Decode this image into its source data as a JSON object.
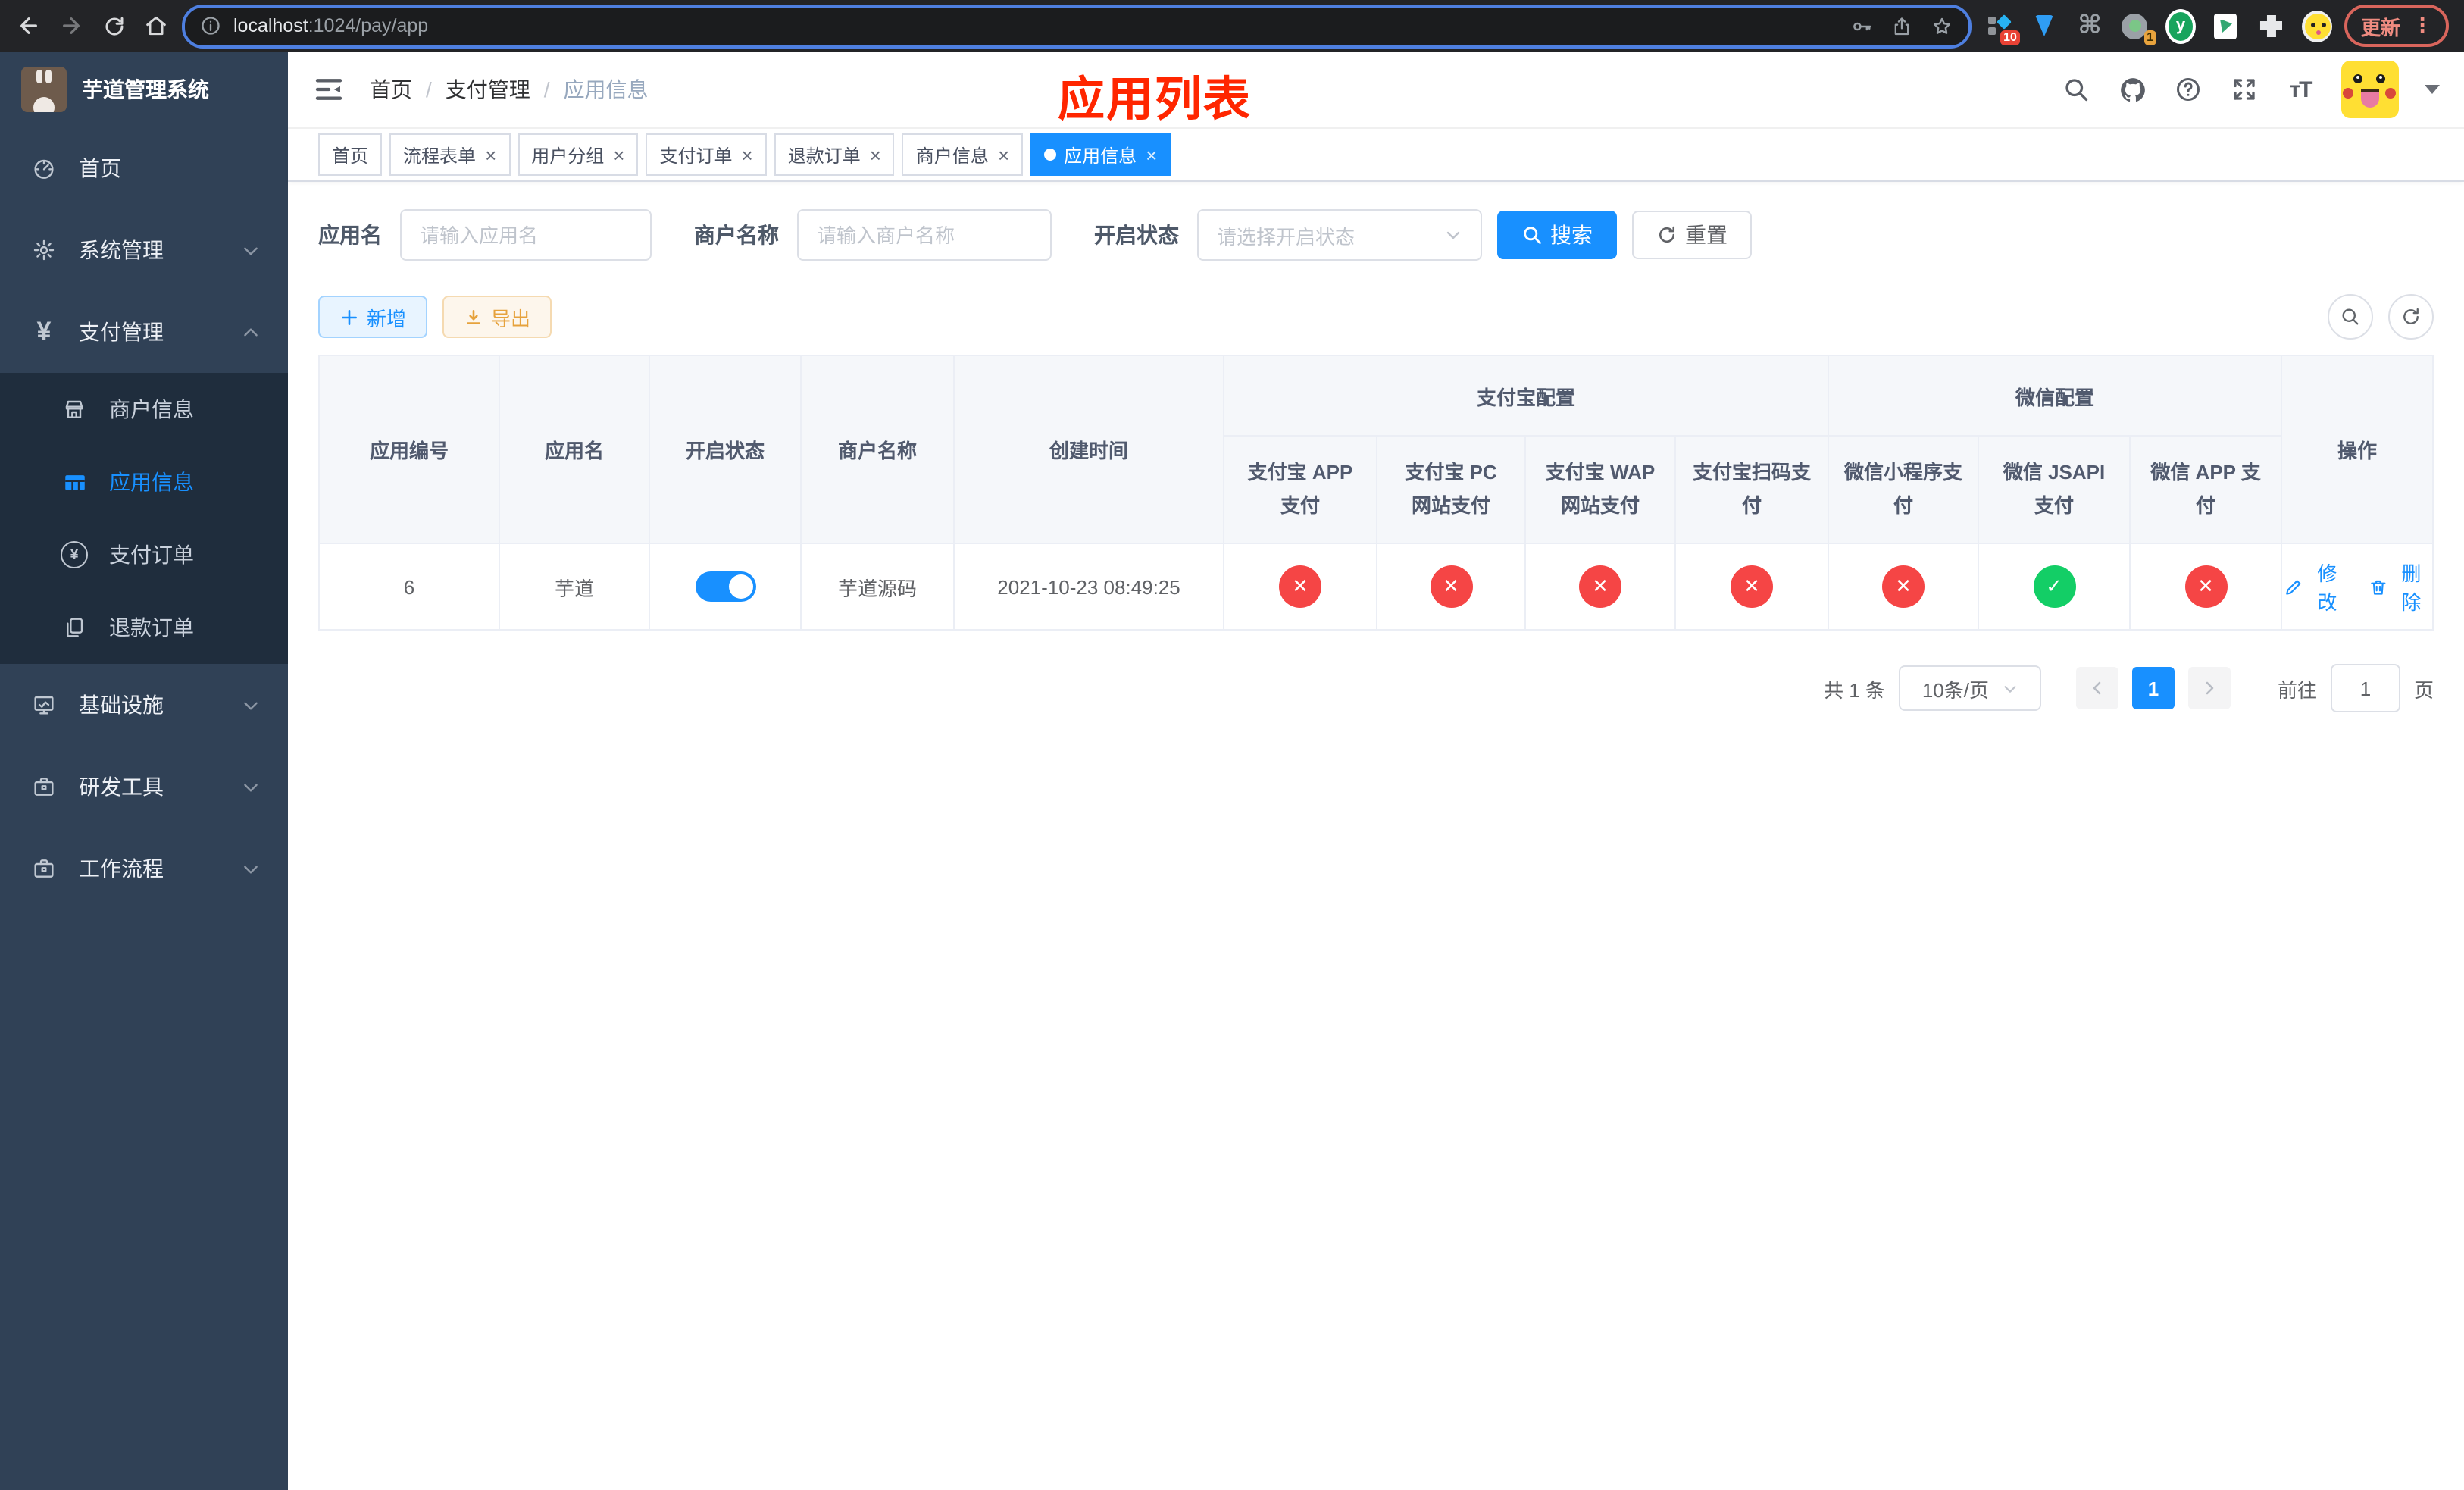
{
  "colors": {
    "primary": "#1890ff",
    "danger": "#f54545",
    "success": "#13ce66",
    "warning": "#e6a23c",
    "annotation": "#ff2600",
    "sidebar_bg": "#304156",
    "submenu_bg": "#1f2d3d"
  },
  "browser": {
    "url_host": "localhost",
    "url_rest": ":1024/pay/app",
    "update_label": "更新",
    "ext_badge_10": "10",
    "ext_badge_1": "1",
    "y_ext_label": "y"
  },
  "sidebar": {
    "title": "芋道管理系统",
    "items": [
      {
        "key": "home",
        "label": "首页",
        "icon": "dashboard-icon"
      },
      {
        "key": "system",
        "label": "系统管理",
        "icon": "gear-icon",
        "chevron": "down"
      },
      {
        "key": "payment",
        "label": "支付管理",
        "icon": "yen-icon",
        "chevron": "up",
        "children": [
          {
            "key": "merchant-info",
            "label": "商户信息",
            "icon": "shop-icon"
          },
          {
            "key": "app-info",
            "label": "应用信息",
            "icon": "grid-icon",
            "active": true
          },
          {
            "key": "pay-order",
            "label": "支付订单",
            "icon": "yen-circle-icon"
          },
          {
            "key": "refund-order",
            "label": "退款订单",
            "icon": "document-icon"
          }
        ]
      },
      {
        "key": "infrastructure",
        "label": "基础设施",
        "icon": "monitor-icon",
        "chevron": "down"
      },
      {
        "key": "dev-tools",
        "label": "研发工具",
        "icon": "toolbox-icon",
        "chevron": "down"
      },
      {
        "key": "workflow",
        "label": "工作流程",
        "icon": "toolbox-icon",
        "chevron": "down"
      }
    ]
  },
  "app_header": {
    "breadcrumb": [
      "首页",
      "支付管理",
      "应用信息"
    ],
    "separator": "/",
    "annotation": "应用列表"
  },
  "tabs": [
    {
      "label": "首页",
      "closable": false,
      "active": false
    },
    {
      "label": "流程表单",
      "closable": true,
      "active": false
    },
    {
      "label": "用户分组",
      "closable": true,
      "active": false
    },
    {
      "label": "支付订单",
      "closable": true,
      "active": false
    },
    {
      "label": "退款订单",
      "closable": true,
      "active": false
    },
    {
      "label": "商户信息",
      "closable": true,
      "active": false
    },
    {
      "label": "应用信息",
      "closable": true,
      "active": true
    }
  ],
  "filters": {
    "app_name_label": "应用名",
    "app_name_placeholder": "请输入应用名",
    "merchant_label": "商户名称",
    "merchant_placeholder": "请输入商户名称",
    "status_label": "开启状态",
    "status_placeholder": "请选择开启状态",
    "search_label": "搜索",
    "reset_label": "重置"
  },
  "toolbar": {
    "add_label": "新增",
    "export_label": "导出"
  },
  "table": {
    "columns": [
      "应用编号",
      "应用名",
      "开启状态",
      "商户名称",
      "创建时间"
    ],
    "group_alipay": "支付宝配置",
    "group_wechat": "微信配置",
    "op_label": "操作",
    "pay_columns": [
      "支付宝 APP 支付",
      "支付宝 PC 网站支付",
      "支付宝 WAP 网站支付",
      "支付宝扫码支付",
      "微信小程序支付",
      "微信 JSAPI 支付",
      "微信 APP 支付"
    ],
    "row": {
      "id": "6",
      "name": "芋道",
      "enabled": true,
      "merchant": "芋道源码",
      "created": "2021-10-23 08:49:25",
      "statuses": [
        "fail",
        "fail",
        "fail",
        "fail",
        "fail",
        "success",
        "fail"
      ],
      "edit_label": "修改",
      "delete_label": "删除"
    }
  },
  "pagination": {
    "total": "共 1 条",
    "page_size": "10条/页",
    "page": "1",
    "goto_label": "前往",
    "goto_value": "1",
    "unit_label": "页"
  }
}
